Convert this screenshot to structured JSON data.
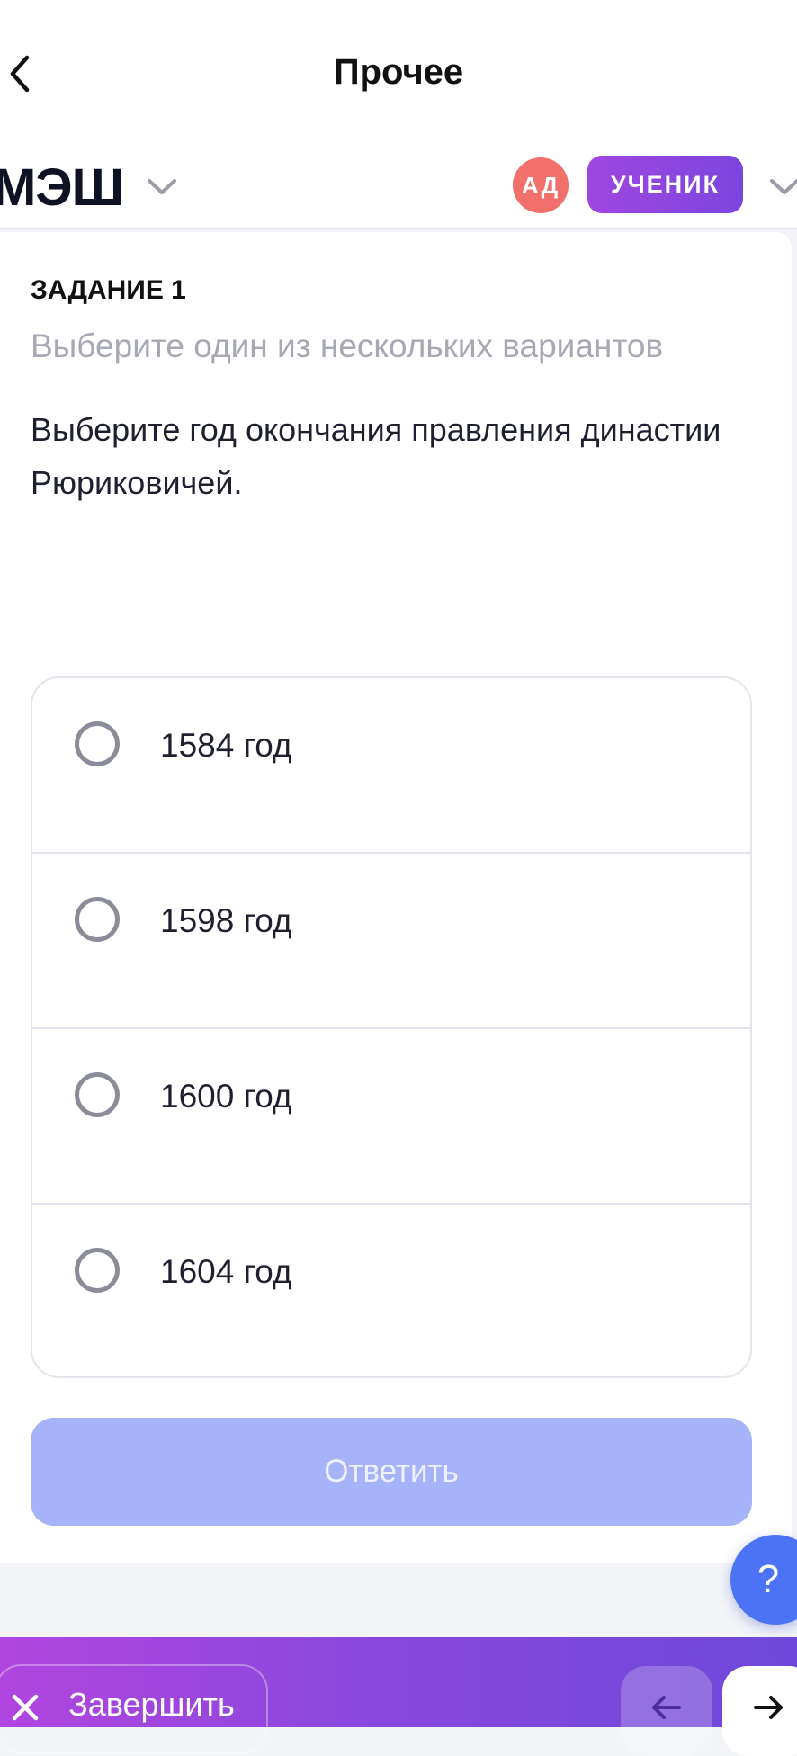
{
  "nav": {
    "title": "Прочее",
    "back_icon": "chevron-left-icon"
  },
  "header": {
    "brand": "МЭШ",
    "brand_menu_icon": "chevron-down-icon",
    "avatar_initials": "АД",
    "avatar_color": "#f2706c",
    "role": "УЧЕНИК",
    "role_color": "#8a46de",
    "profile_menu_icon": "chevron-down-icon"
  },
  "task": {
    "number_label": "ЗАДАНИЕ 1",
    "hint": "Выберите один из нескольких вариантов",
    "question": "Выберите год окончания правления династии Рюриковичей.",
    "options": [
      {
        "label": "1584 год",
        "selected": false
      },
      {
        "label": "1598 год",
        "selected": false
      },
      {
        "label": "1600 год",
        "selected": false
      },
      {
        "label": "1604 год",
        "selected": false
      }
    ],
    "submit_label": "Ответить",
    "submit_color": "#a6b3f8"
  },
  "help": {
    "label": "?",
    "color": "#4c72f5"
  },
  "footer": {
    "finish_label": "Завершить",
    "finish_icon": "close-icon",
    "prev_icon": "arrow-left-icon",
    "next_icon": "arrow-right-icon"
  }
}
